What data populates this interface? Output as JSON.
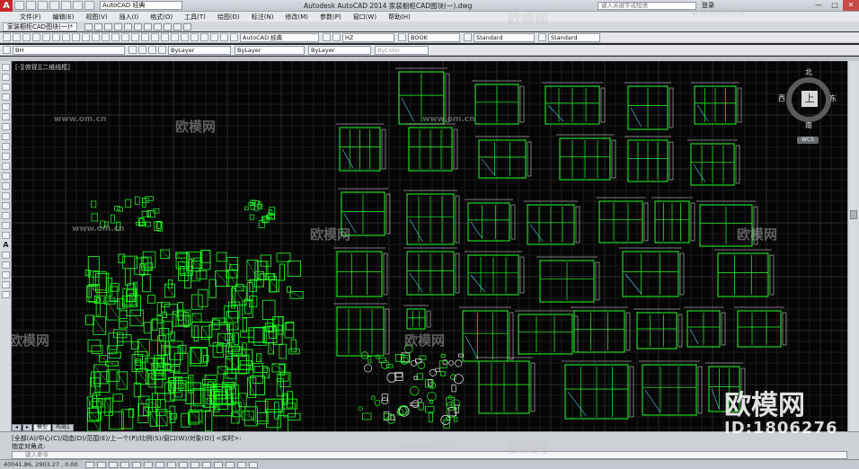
{
  "titlebar": {
    "app_logo": "A",
    "workspace": "AutoCAD 经典",
    "title": "Autodesk AutoCAD 2014    家装橱柜CAD图块(一).dwg",
    "search_placeholder": "键入关键字或短语",
    "login": "登录",
    "min": "—",
    "max": "□",
    "close": "✕"
  },
  "menu": [
    "文件(F)",
    "编辑(E)",
    "视图(V)",
    "插入(I)",
    "格式(O)",
    "工具(T)",
    "绘图(D)",
    "标注(N)",
    "修改(M)",
    "参数(P)",
    "窗口(W)",
    "帮助(H)"
  ],
  "doc_tab": "家装橱柜CAD图块(一)*",
  "toolbar": {
    "workspace_select": "AutoCAD 经典",
    "text_style": "HZ",
    "dim_style": "BOOK",
    "table_style": "Standard",
    "mleader_style": "Standard",
    "layer": "BH",
    "color": "ByLayer",
    "linetype": "ByLayer",
    "lineweight": "ByLayer",
    "plotstyle": "ByColor"
  },
  "viewport_label": "[-][俯视][二维线框]",
  "viewcube": {
    "north": "北",
    "south": "南",
    "east": "东",
    "west": "西",
    "face": "上",
    "wcs": "WCS"
  },
  "layout_tabs": [
    "模型",
    "布局1"
  ],
  "command": {
    "history1": "[全部(A)/中心(C)/动态(D)/范围(E)/上一个(P)/比例(S)/窗口(W)/对象(O)] <实时>:",
    "history2": "指定对角点:",
    "input_placeholder": "键入命令"
  },
  "status": {
    "coords": "40041.86, 2903.27 , 0.00"
  },
  "watermark": {
    "site": "www.om.cn",
    "logo": "欧模网",
    "id": "ID:1806276"
  },
  "colors": {
    "canvas": "#050505",
    "drawing": "#22ff22",
    "accent": "#c8262b"
  }
}
